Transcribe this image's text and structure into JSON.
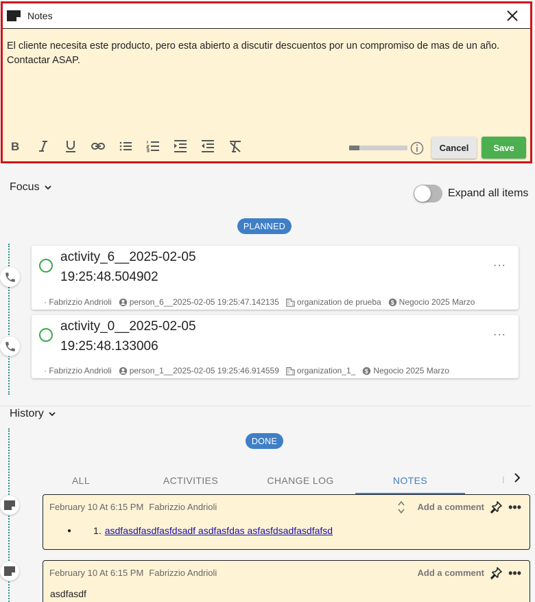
{
  "editor": {
    "title": "Notes",
    "text": "El cliente necesita este producto, pero esta abierto a discutir descuentos por un compromiso de mas de un año. Contactar ASAP.",
    "progress": 0.18,
    "cancel_label": "Cancel",
    "save_label": "Save",
    "toolbar": [
      "bold-icon",
      "italic-icon",
      "underline-icon",
      "link-icon",
      "bulleted-list-icon",
      "numbered-list-icon",
      "indent-icon",
      "outdent-icon",
      "clear-format-icon"
    ]
  },
  "focus": {
    "title": "Focus",
    "expand_label": "Expand all items",
    "planned_label": "PLANNED",
    "activities": [
      {
        "name": "activity_6__2025-02-05 19:25:48.504902",
        "user": "· Fabrizzio Andrioli",
        "person": "person_6__2025-02-05 19:25:47.142135",
        "organization": "organization de prueba",
        "deal": "Negocio 2025 Marzo"
      },
      {
        "name": "activity_0__2025-02-05 19:25:48.133006",
        "user": "· Fabrizzio Andrioli",
        "person": "person_1__2025-02-05 19:25:46.914559",
        "organization": "organization_1_",
        "deal": "Negocio 2025 Marzo"
      }
    ],
    "more_label": "···"
  },
  "history": {
    "title": "History",
    "done_label": "DONE",
    "tabs": [
      "ALL",
      "ACTIVITIES",
      "CHANGE LOG",
      "NOTES"
    ],
    "active_tab": "NOTES",
    "notes": [
      {
        "date": "February 10 At 6:15 PM",
        "author": "Fabrizzio Andrioli",
        "add_comment": "Add a comment",
        "list_number": "1.",
        "link_text": "asdfasdfasdfasfdsadf asdfasfdas asfasfdsadfasdfafsd"
      },
      {
        "date": "February 10 At 6:15 PM",
        "author": "Fabrizzio Andrioli",
        "add_comment": "Add a comment",
        "body": "asdfasdf"
      }
    ]
  },
  "colors": {
    "editor_border": "#d0141a",
    "editor_bg": "#fff3d6",
    "save_green": "#4caf50",
    "pill_blue": "#3f7fc5",
    "check_green": "#3ea84a",
    "timeline_teal": "#2b8e86"
  }
}
